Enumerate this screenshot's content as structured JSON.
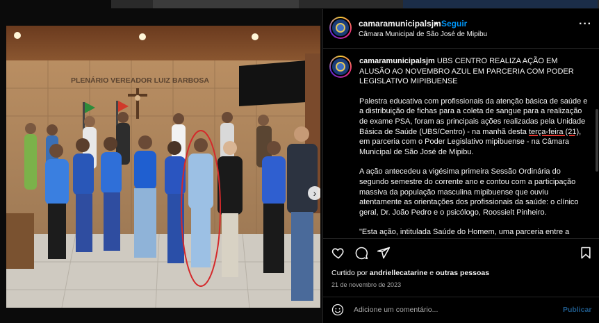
{
  "account": {
    "username": "camaramunicipalsjm",
    "separator": "•",
    "follow_label": "Seguir",
    "subtitle": "Câmara Municipal de São José de Mipibu",
    "more_label": "···"
  },
  "photo": {
    "wall_sign": "PLENÁRIO VEREADOR LUIZ BARBOSA",
    "next_label": "›",
    "slide_index": 1,
    "slide_count": 3
  },
  "caption": {
    "username": "camaramunicipalsjm",
    "headline": "UBS CENTRO REALIZA AÇÃO EM ALUSÃO AO NOVEMBRO AZUL EM PARCERIA COM PODER LEGISLATIVO MIPIBUENSE",
    "p1_before": "Palestra educativa com profissionais da atenção básica de saúde e a distribuição de fichas para a coleta de sangue para a realização de exame PSA, foram as principais ações realizadas pela Unidade Básica de Saúde (UBS/Centro) - na manhã desta ",
    "p1_highlight": "terça-feira (21)",
    "p1_after": ", em parceria com o Poder Legislativo mipibuense - na Câmara Municipal de São José de Mipibu.",
    "p2": "A ação antecedeu a vigésima primeira Sessão Ordinária do segundo semestre do corrente ano e contou com a participação massiva da população masculina mipibuense que ouviu atentamente as orientações dos profissionais da saúde: o clínico geral, Dr. João Pedro e o psicólogo, Roossielt Pinheiro.",
    "p3": "\"Esta ação, intitulada Saúde do Homem, uma parceria entre a"
  },
  "actions": {
    "icons": [
      "heart-icon",
      "comment-icon",
      "share-icon",
      "bookmark-icon"
    ],
    "liked_prefix": "Curtido por ",
    "liked_user": "andriellecatarine",
    "liked_middle": " e ",
    "liked_others": "outras pessoas",
    "date": "21 de novembro de 2023"
  },
  "comment": {
    "placeholder": "Adicione um comentário...",
    "publish_label": "Publicar"
  },
  "colors": {
    "accent": "#0095f6",
    "highlight_underline": "#e0342b",
    "annotation_circle": "#d4292b"
  }
}
